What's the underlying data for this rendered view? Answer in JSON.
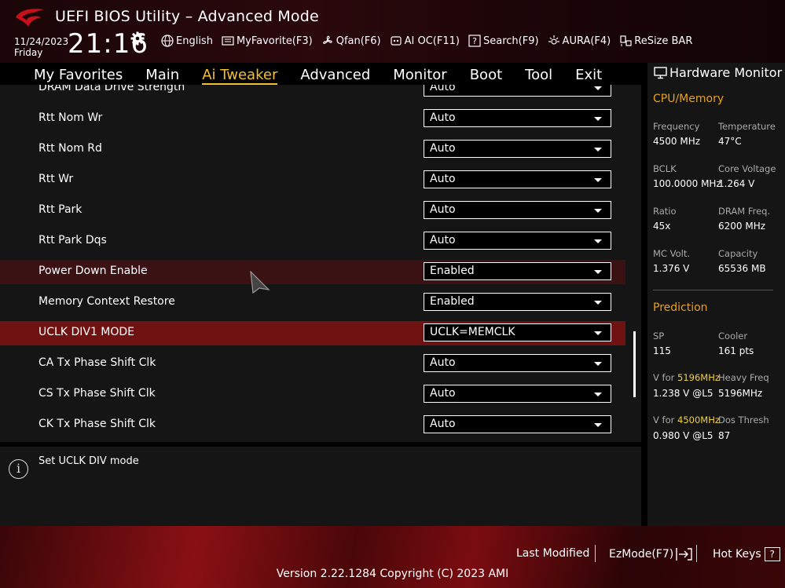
{
  "header": {
    "title": "UEFI BIOS Utility – Advanced Mode",
    "date": "11/24/2023",
    "day": "Friday",
    "time": "21:16",
    "toolbar": [
      {
        "label": "English",
        "icon": "globe-icon"
      },
      {
        "label": "MyFavorite(F3)",
        "icon": "favorite-icon"
      },
      {
        "label": "Qfan(F6)",
        "icon": "fan-icon"
      },
      {
        "label": "AI OC(F11)",
        "icon": "ai-oc-icon"
      },
      {
        "label": "Search(F9)",
        "icon": "search-icon"
      },
      {
        "label": "AURA(F4)",
        "icon": "aura-icon"
      },
      {
        "label": "ReSize BAR",
        "icon": "resize-bar-icon"
      }
    ]
  },
  "nav": {
    "tabs": [
      "My Favorites",
      "Main",
      "Ai Tweaker",
      "Advanced",
      "Monitor",
      "Boot",
      "Tool",
      "Exit"
    ],
    "active": "Ai Tweaker"
  },
  "settings": [
    {
      "label": "DRAM Data Drive Strength",
      "value": "Auto"
    },
    {
      "label": "Rtt Nom Wr",
      "value": "Auto"
    },
    {
      "label": "Rtt Nom Rd",
      "value": "Auto"
    },
    {
      "label": "Rtt Wr",
      "value": "Auto"
    },
    {
      "label": "Rtt Park",
      "value": "Auto"
    },
    {
      "label": "Rtt Park Dqs",
      "value": "Auto"
    },
    {
      "label": "Power Down Enable",
      "value": "Enabled"
    },
    {
      "label": "Memory Context Restore",
      "value": "Enabled"
    },
    {
      "label": "UCLK DIV1 MODE",
      "value": "UCLK=MEMCLK"
    },
    {
      "label": "CA Tx Phase Shift Clk",
      "value": "Auto"
    },
    {
      "label": "CS Tx Phase Shift Clk",
      "value": "Auto"
    },
    {
      "label": "CK Tx Phase Shift Clk",
      "value": "Auto"
    }
  ],
  "help": {
    "text": "Set UCLK DIV mode"
  },
  "hardware_monitor": {
    "title": "Hardware Monitor",
    "cpu_memory": {
      "title": "CPU/Memory",
      "items": [
        {
          "label": "Frequency",
          "value": "4500 MHz"
        },
        {
          "label": "Temperature",
          "value": "47°C"
        },
        {
          "label": "BCLK",
          "value": "100.0000 MHz"
        },
        {
          "label": "Core Voltage",
          "value": "1.264 V"
        },
        {
          "label": "Ratio",
          "value": "45x"
        },
        {
          "label": "DRAM Freq.",
          "value": "6200 MHz"
        },
        {
          "label": "MC Volt.",
          "value": "1.376 V"
        },
        {
          "label": "Capacity",
          "value": "65536 MB"
        }
      ]
    },
    "prediction": {
      "title": "Prediction",
      "sp_label": "SP",
      "sp_value": "115",
      "cooler_label": "Cooler",
      "cooler_value": "161 pts",
      "v_for_label": "V for",
      "v1_freq": "5196MHz",
      "v1_value": "1.238 V @L5",
      "heavy_freq_label": "Heavy Freq",
      "heavy_freq_value": "5196MHz",
      "v2_freq": "4500MHz",
      "v2_value": "0.980 V @L5",
      "dos_thresh_label": "Dos Thresh",
      "dos_thresh_value": "87"
    }
  },
  "footer": {
    "last_modified": "Last Modified",
    "ezmode": "EzMode(F7)",
    "hotkeys": "Hot Keys",
    "hotkeys_key": "?",
    "version": "Version 2.22.1284 Copyright (C) 2023 AMI"
  }
}
